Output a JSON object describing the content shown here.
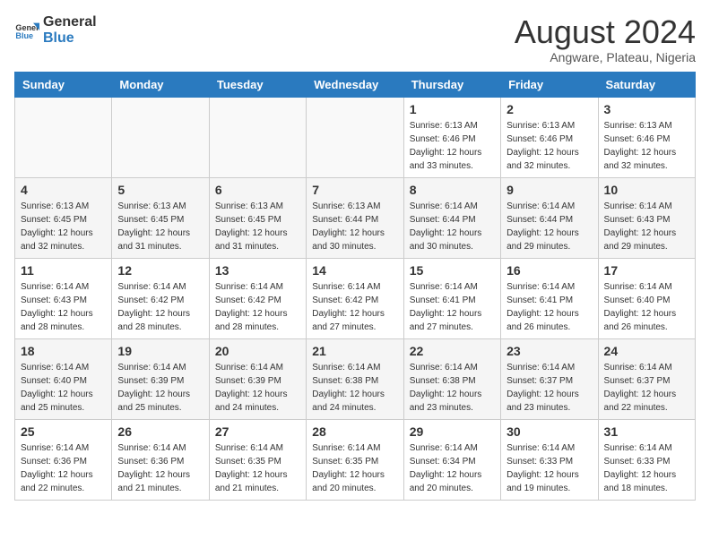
{
  "logo": {
    "text_general": "General",
    "text_blue": "Blue"
  },
  "title": "August 2024",
  "subtitle": "Angware, Plateau, Nigeria",
  "days_of_week": [
    "Sunday",
    "Monday",
    "Tuesday",
    "Wednesday",
    "Thursday",
    "Friday",
    "Saturday"
  ],
  "weeks": [
    [
      {
        "day": "",
        "info": ""
      },
      {
        "day": "",
        "info": ""
      },
      {
        "day": "",
        "info": ""
      },
      {
        "day": "",
        "info": ""
      },
      {
        "day": "1",
        "info": "Sunrise: 6:13 AM\nSunset: 6:46 PM\nDaylight: 12 hours\nand 33 minutes."
      },
      {
        "day": "2",
        "info": "Sunrise: 6:13 AM\nSunset: 6:46 PM\nDaylight: 12 hours\nand 32 minutes."
      },
      {
        "day": "3",
        "info": "Sunrise: 6:13 AM\nSunset: 6:46 PM\nDaylight: 12 hours\nand 32 minutes."
      }
    ],
    [
      {
        "day": "4",
        "info": "Sunrise: 6:13 AM\nSunset: 6:45 PM\nDaylight: 12 hours\nand 32 minutes."
      },
      {
        "day": "5",
        "info": "Sunrise: 6:13 AM\nSunset: 6:45 PM\nDaylight: 12 hours\nand 31 minutes."
      },
      {
        "day": "6",
        "info": "Sunrise: 6:13 AM\nSunset: 6:45 PM\nDaylight: 12 hours\nand 31 minutes."
      },
      {
        "day": "7",
        "info": "Sunrise: 6:13 AM\nSunset: 6:44 PM\nDaylight: 12 hours\nand 30 minutes."
      },
      {
        "day": "8",
        "info": "Sunrise: 6:14 AM\nSunset: 6:44 PM\nDaylight: 12 hours\nand 30 minutes."
      },
      {
        "day": "9",
        "info": "Sunrise: 6:14 AM\nSunset: 6:44 PM\nDaylight: 12 hours\nand 29 minutes."
      },
      {
        "day": "10",
        "info": "Sunrise: 6:14 AM\nSunset: 6:43 PM\nDaylight: 12 hours\nand 29 minutes."
      }
    ],
    [
      {
        "day": "11",
        "info": "Sunrise: 6:14 AM\nSunset: 6:43 PM\nDaylight: 12 hours\nand 28 minutes."
      },
      {
        "day": "12",
        "info": "Sunrise: 6:14 AM\nSunset: 6:42 PM\nDaylight: 12 hours\nand 28 minutes."
      },
      {
        "day": "13",
        "info": "Sunrise: 6:14 AM\nSunset: 6:42 PM\nDaylight: 12 hours\nand 28 minutes."
      },
      {
        "day": "14",
        "info": "Sunrise: 6:14 AM\nSunset: 6:42 PM\nDaylight: 12 hours\nand 27 minutes."
      },
      {
        "day": "15",
        "info": "Sunrise: 6:14 AM\nSunset: 6:41 PM\nDaylight: 12 hours\nand 27 minutes."
      },
      {
        "day": "16",
        "info": "Sunrise: 6:14 AM\nSunset: 6:41 PM\nDaylight: 12 hours\nand 26 minutes."
      },
      {
        "day": "17",
        "info": "Sunrise: 6:14 AM\nSunset: 6:40 PM\nDaylight: 12 hours\nand 26 minutes."
      }
    ],
    [
      {
        "day": "18",
        "info": "Sunrise: 6:14 AM\nSunset: 6:40 PM\nDaylight: 12 hours\nand 25 minutes."
      },
      {
        "day": "19",
        "info": "Sunrise: 6:14 AM\nSunset: 6:39 PM\nDaylight: 12 hours\nand 25 minutes."
      },
      {
        "day": "20",
        "info": "Sunrise: 6:14 AM\nSunset: 6:39 PM\nDaylight: 12 hours\nand 24 minutes."
      },
      {
        "day": "21",
        "info": "Sunrise: 6:14 AM\nSunset: 6:38 PM\nDaylight: 12 hours\nand 24 minutes."
      },
      {
        "day": "22",
        "info": "Sunrise: 6:14 AM\nSunset: 6:38 PM\nDaylight: 12 hours\nand 23 minutes."
      },
      {
        "day": "23",
        "info": "Sunrise: 6:14 AM\nSunset: 6:37 PM\nDaylight: 12 hours\nand 23 minutes."
      },
      {
        "day": "24",
        "info": "Sunrise: 6:14 AM\nSunset: 6:37 PM\nDaylight: 12 hours\nand 22 minutes."
      }
    ],
    [
      {
        "day": "25",
        "info": "Sunrise: 6:14 AM\nSunset: 6:36 PM\nDaylight: 12 hours\nand 22 minutes."
      },
      {
        "day": "26",
        "info": "Sunrise: 6:14 AM\nSunset: 6:36 PM\nDaylight: 12 hours\nand 21 minutes."
      },
      {
        "day": "27",
        "info": "Sunrise: 6:14 AM\nSunset: 6:35 PM\nDaylight: 12 hours\nand 21 minutes."
      },
      {
        "day": "28",
        "info": "Sunrise: 6:14 AM\nSunset: 6:35 PM\nDaylight: 12 hours\nand 20 minutes."
      },
      {
        "day": "29",
        "info": "Sunrise: 6:14 AM\nSunset: 6:34 PM\nDaylight: 12 hours\nand 20 minutes."
      },
      {
        "day": "30",
        "info": "Sunrise: 6:14 AM\nSunset: 6:33 PM\nDaylight: 12 hours\nand 19 minutes."
      },
      {
        "day": "31",
        "info": "Sunrise: 6:14 AM\nSunset: 6:33 PM\nDaylight: 12 hours\nand 18 minutes."
      }
    ]
  ]
}
